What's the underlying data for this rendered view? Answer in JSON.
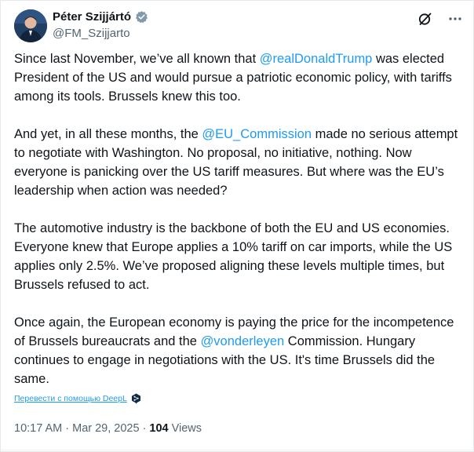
{
  "author": {
    "display_name": "Péter Szijjártó",
    "handle": "@FM_Szijjarto",
    "verified": true,
    "verified_color": "#829aab"
  },
  "tweet": {
    "paragraphs": [
      [
        {
          "text": "Since last November, we’ve all known that ",
          "mention": false
        },
        {
          "text": "@realDonaldTrump",
          "mention": true
        },
        {
          "text": " was elected President of the US and would pursue a patriotic economic policy, with tariffs among its tools. Brussels knew this too.",
          "mention": false
        }
      ],
      [
        {
          "text": "And yet, in all these months, the ",
          "mention": false
        },
        {
          "text": "@EU_Commission",
          "mention": true
        },
        {
          "text": " made no serious attempt to negotiate with Washington. No proposal, no initiative, nothing. Now everyone is panicking over the US tariff measures. But where was the EU’s leadership when action was needed?",
          "mention": false
        }
      ],
      [
        {
          "text": "The automotive industry is the backbone of both the EU and US economies. Everyone knew that Europe applies a 10% tariff on car imports, while the US applies only 2.5%. We’ve proposed aligning these levels multiple times, but Brussels refused to act.",
          "mention": false
        }
      ],
      [
        {
          "text": "Once again, the European economy is paying the price for the incompetence of Brussels bureaucrats and the ",
          "mention": false
        },
        {
          "text": "@vonderleyen",
          "mention": true
        },
        {
          "text": " Commission. Hungary continues to engage in negotiations with the US. It's time Brussels did the same.",
          "mention": false
        }
      ]
    ],
    "translate_label": "Перевести с помощью DeepL",
    "time": "10:17 AM",
    "separator": "·",
    "date": "Mar 29, 2025",
    "views_count": "104",
    "views_label": "Views"
  },
  "icons": {
    "verified": "verified-badge-icon",
    "grok": "grok-icon",
    "more": "more-icon",
    "deepl": "deepl-icon"
  },
  "colors": {
    "mention": "#1d9bf0",
    "secondary_text": "#536471",
    "primary_text": "#0f1419"
  }
}
